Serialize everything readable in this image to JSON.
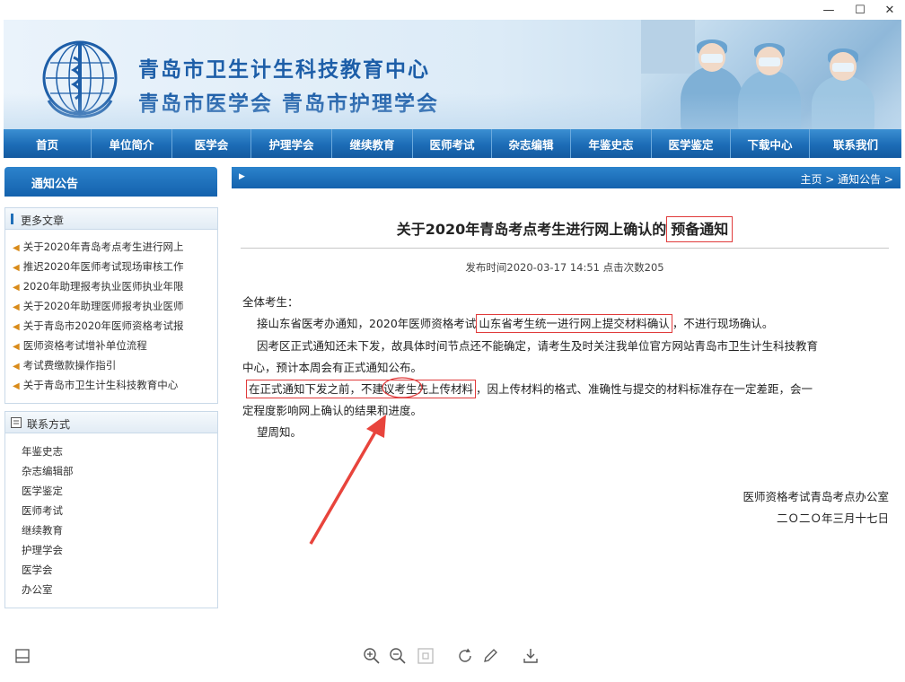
{
  "window": {
    "minimize": "—",
    "maximize": "☐",
    "close": "✕"
  },
  "header": {
    "title_line1": "青岛市卫生计生科技教育中心",
    "title_line2": "青岛市医学会  青岛市护理学会"
  },
  "nav": {
    "items": [
      "首页",
      "单位简介",
      "医学会",
      "护理学会",
      "继续教育",
      "医师考试",
      "杂志编辑",
      "年鉴史志",
      "医学鉴定",
      "下载中心",
      "联系我们"
    ]
  },
  "sidebar": {
    "notice_title": "通知公告",
    "more_title": "更多文章",
    "articles": [
      "关于2020年青岛考点考生进行网上",
      "推迟2020年医师考试现场审核工作",
      "2020年助理报考执业医师执业年限",
      "关于2020年助理医师报考执业医师",
      "关于青岛市2020年医师资格考试报",
      "医师资格考试增补单位流程",
      "考试费缴款操作指引",
      "关于青岛市卫生计生科技教育中心"
    ],
    "contact_title": "联系方式",
    "links": [
      "年鉴史志",
      "杂志编辑部",
      "医学鉴定",
      "医师考试",
      "继续教育",
      "护理学会",
      "医学会",
      "办公室"
    ]
  },
  "main": {
    "breadcrumb": "主页 > 通知公告 >",
    "title_prefix": "关于2020年青岛考点考生进行网上确认的",
    "title_highlight": "预备通知",
    "meta": "发布时间2020-03-17 14:51    点击次数205",
    "greeting": "全体考生：",
    "p1_a": "接山东省医考办通知，2020年医师资格考试",
    "p1_box": "山东省考生统一进行网上提交材料确认",
    "p1_b": "，不进行现场确认。",
    "p2_a": "因考区正式通知还未下发，故具体时间节点还不能确定，请考生及时关注我单位官方网站青岛市卫生计生科技教育",
    "p2_b": "中心，预计本周会有正式通知公布。",
    "p3_box": "在正式通知下发之前，不建议考生先上传材料",
    "p3_b": "，因上传材料的格式、准确性与提交的材料标准存在一定差距，会一",
    "p3_c": "定程度影响网上确认的结果和进度。",
    "p4": "望周知。",
    "sign1": "医师资格考试青岛考点办公室",
    "sign2": "二Ｏ二Ｏ年三月十七日"
  },
  "toolbar": {
    "icons": [
      "panel-icon",
      "zoom-in-icon",
      "zoom-out-icon",
      "fit-icon",
      "rotate-icon",
      "edit-icon",
      "download-icon"
    ]
  }
}
